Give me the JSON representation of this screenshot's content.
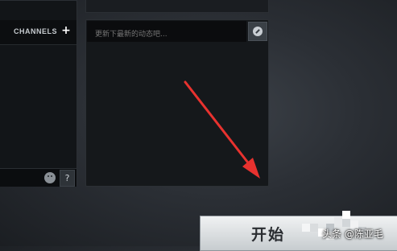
{
  "channels_panel": {
    "header_label": "CHANNELS",
    "add_icon": "plus-icon",
    "emoji_icon": "smiley-icon",
    "help_label": "?"
  },
  "feed_panel": {
    "status_placeholder": "更新下最新的动态吧...",
    "post_icon": "edit-icon"
  },
  "start_button": {
    "label": "开始"
  },
  "watermark": {
    "text": "头条 @陈亚毛"
  },
  "colors": {
    "annotation_arrow": "#e8322f",
    "background": "#2b2f35",
    "panel": "#15181b"
  }
}
